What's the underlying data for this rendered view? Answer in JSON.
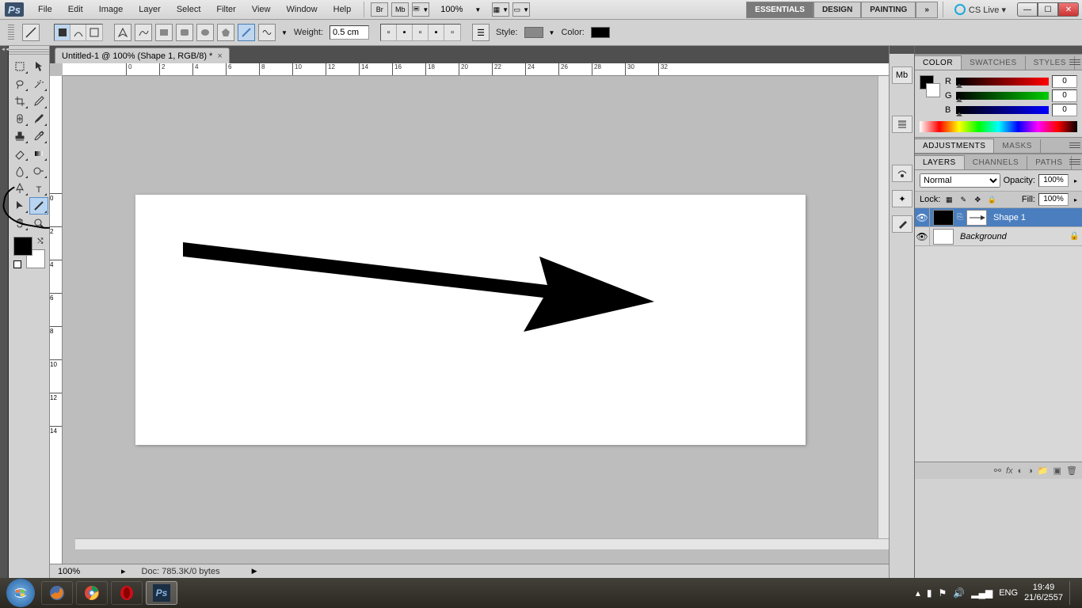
{
  "app": {
    "logo_text": "Ps"
  },
  "menu": [
    "File",
    "Edit",
    "Image",
    "Layer",
    "Select",
    "Filter",
    "View",
    "Window",
    "Help"
  ],
  "topbar": {
    "br": "Br",
    "mb": "Mb",
    "zoom": "100%",
    "workspaces": [
      "ESSENTIALS",
      "DESIGN",
      "PAINTING"
    ],
    "more": "»",
    "cslive": "CS Live ▾"
  },
  "options": {
    "weight_label": "Weight:",
    "weight_value": "0.5 cm",
    "style_label": "Style:",
    "color_label": "Color:"
  },
  "doc": {
    "tab_title": "Untitled-1 @ 100% (Shape 1, RGB/8) *",
    "status_zoom": "100%",
    "status_doc": "Doc: 785.3K/0 bytes",
    "ruler_h": [
      0,
      2,
      4,
      6,
      8,
      10,
      12,
      14,
      16,
      18,
      20,
      22,
      24,
      26,
      28,
      30,
      32
    ],
    "ruler_v": [
      0,
      2,
      4,
      6,
      8,
      10,
      12,
      14
    ]
  },
  "color": {
    "tabs": [
      "COLOR",
      "SWATCHES",
      "STYLES"
    ],
    "r_label": "R",
    "g_label": "G",
    "b_label": "B",
    "r": "0",
    "g": "0",
    "b": "0"
  },
  "adjustments": {
    "tabs": [
      "ADJUSTMENTS",
      "MASKS"
    ]
  },
  "layers": {
    "tabs": [
      "LAYERS",
      "CHANNELS",
      "PATHS"
    ],
    "blend_mode": "Normal",
    "opacity_label": "Opacity:",
    "opacity": "100%",
    "lock_label": "Lock:",
    "fill_label": "Fill:",
    "fill": "100%",
    "items": [
      {
        "name": "Shape 1",
        "sel": true,
        "ital": false,
        "locked": false
      },
      {
        "name": "Background",
        "sel": false,
        "ital": true,
        "locked": true
      }
    ]
  },
  "taskbar": {
    "lang": "ENG",
    "time": "19:49",
    "date": "21/6/2557"
  }
}
